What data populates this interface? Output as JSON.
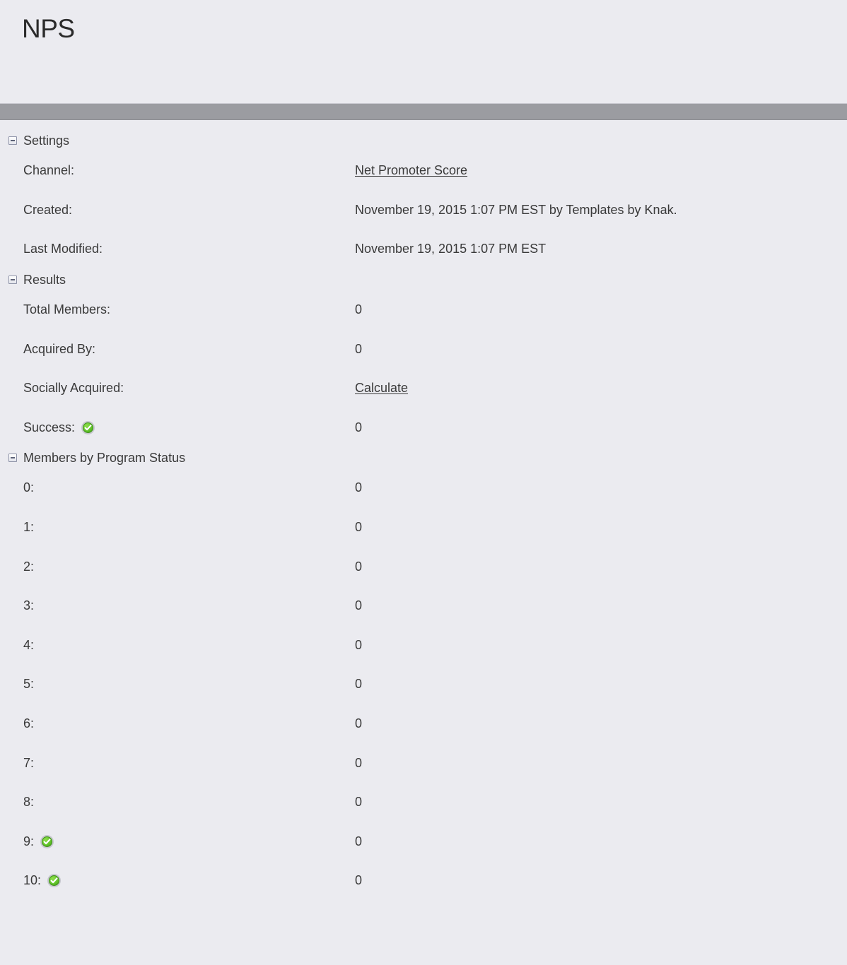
{
  "page": {
    "title": "NPS"
  },
  "sections": [
    {
      "id": "settings",
      "title": "Settings",
      "toggle_icon": "collapse-box-icon",
      "rows": [
        {
          "label": "Channel:",
          "value": "Net Promoter Score",
          "value_type": "link",
          "has_icon": false
        },
        {
          "label": "Created:",
          "value": "November 19, 2015 1:07 PM EST by Templates by Knak.",
          "value_type": "text",
          "has_icon": false
        },
        {
          "label": "Last Modified:",
          "value": "November 19, 2015 1:07 PM EST",
          "value_type": "text",
          "has_icon": false
        }
      ]
    },
    {
      "id": "results",
      "title": "Results",
      "toggle_icon": "collapse-box-icon",
      "rows": [
        {
          "label": "Total Members:",
          "value": "0",
          "value_type": "text",
          "has_icon": false
        },
        {
          "label": "Acquired By:",
          "value": "0",
          "value_type": "text",
          "has_icon": false
        },
        {
          "label": "Socially Acquired:",
          "value": "Calculate",
          "value_type": "link",
          "has_icon": false
        },
        {
          "label": "Success:",
          "value": "0",
          "value_type": "text",
          "has_icon": true,
          "icon": "success-check-icon"
        }
      ]
    },
    {
      "id": "members-by-program-status",
      "title": "Members by Program Status",
      "toggle_icon": "collapse-box-icon",
      "rows": [
        {
          "label": "0:",
          "value": "0",
          "value_type": "text",
          "has_icon": false
        },
        {
          "label": "1:",
          "value": "0",
          "value_type": "text",
          "has_icon": false
        },
        {
          "label": "2:",
          "value": "0",
          "value_type": "text",
          "has_icon": false
        },
        {
          "label": "3:",
          "value": "0",
          "value_type": "text",
          "has_icon": false
        },
        {
          "label": "4:",
          "value": "0",
          "value_type": "text",
          "has_icon": false
        },
        {
          "label": "5:",
          "value": "0",
          "value_type": "text",
          "has_icon": false
        },
        {
          "label": "6:",
          "value": "0",
          "value_type": "text",
          "has_icon": false
        },
        {
          "label": "7:",
          "value": "0",
          "value_type": "text",
          "has_icon": false
        },
        {
          "label": "8:",
          "value": "0",
          "value_type": "text",
          "has_icon": false
        },
        {
          "label": "9:",
          "value": "0",
          "value_type": "text",
          "has_icon": true,
          "icon": "success-check-icon"
        },
        {
          "label": "10:",
          "value": "0",
          "value_type": "text",
          "has_icon": true,
          "icon": "success-check-icon"
        }
      ]
    }
  ],
  "colors": {
    "background": "#ebebf0",
    "divider_band": "#9b9ca1",
    "link": "#2f3a6b",
    "text": "#3a3a3a",
    "success_green": "#65c62c"
  }
}
